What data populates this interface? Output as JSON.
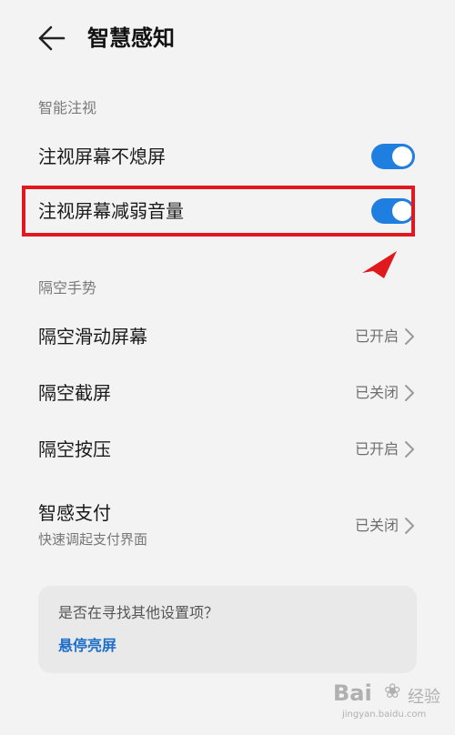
{
  "header": {
    "title": "智慧感知",
    "back_icon": "back-arrow-icon"
  },
  "sections": {
    "gaze": {
      "label": "智能注视",
      "items": [
        {
          "label": "注视屏幕不熄屏",
          "toggle_on": true
        },
        {
          "label": "注视屏幕减弱音量",
          "toggle_on": true
        }
      ]
    },
    "air_gesture": {
      "label": "隔空手势",
      "items": [
        {
          "label": "隔空滑动屏幕",
          "status": "已开启"
        },
        {
          "label": "隔空截屏",
          "status": "已关闭"
        },
        {
          "label": "隔空按压",
          "status": "已开启"
        },
        {
          "label": "智感支付",
          "subtitle": "快速调起支付界面",
          "status": "已关闭"
        }
      ]
    }
  },
  "suggest": {
    "question": "是否在寻找其他设置项？",
    "link": "悬停亮屏"
  },
  "watermark": {
    "brand_a": "Bai",
    "brand_b": "经验",
    "url": "jingyan.baidu.com"
  },
  "colors": {
    "accent": "#1f7fe0",
    "highlight": "#e0191e",
    "link": "#1f6fc8"
  }
}
